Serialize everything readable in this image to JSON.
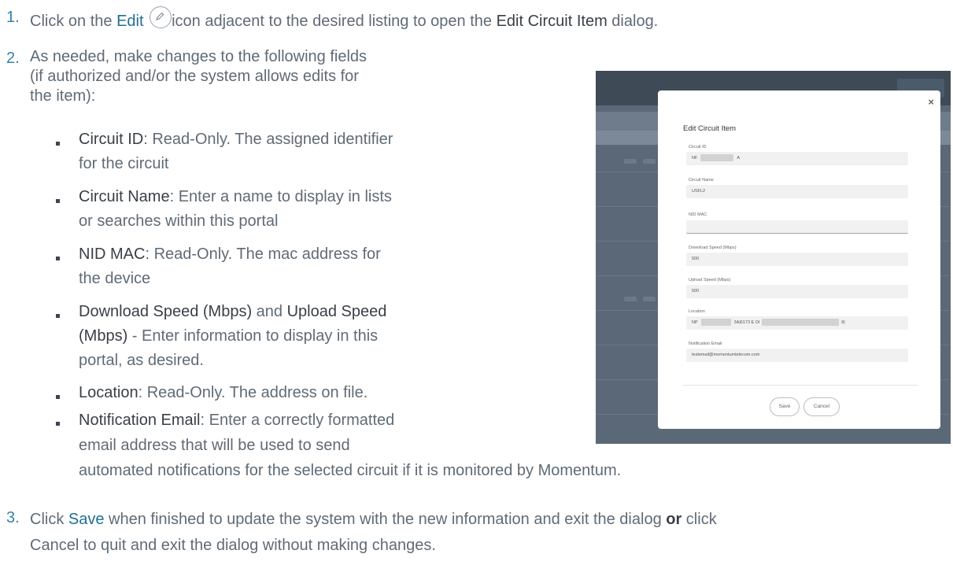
{
  "steps": {
    "s1": {
      "num": "1.",
      "pre": "Click on the ",
      "edit": "Edit",
      "mid": "icon adjacent to the desired listing to open the ",
      "dialog": "Edit Circuit Item",
      "post": " dialog."
    },
    "s2": {
      "num": "2.",
      "line1": "As needed, make changes to the following fields",
      "line2": "(if authorized and/or the system allows edits for",
      "line3": "the item):"
    },
    "s3": {
      "num": "3.",
      "pre": "Click ",
      "save": "Save",
      "line1_rest": " when finished to update the system with the new information and exit the dialog ",
      "or": "or",
      "line1_end": " click",
      "cancel": "Cancel",
      "line2_rest": " to quit and exit the dialog without making changes."
    }
  },
  "bullets": {
    "circuit_id": {
      "label": "Circuit ID",
      "line1": ": Read-Only. The assigned identifier",
      "line2": "for the circuit"
    },
    "circuit_name": {
      "label": "Circuit Name",
      "line1": ": Enter a name to display in lists",
      "line2": "or searches within this portal"
    },
    "nid_mac": {
      "label": "NID MAC",
      "line1": ": Read-Only. The mac address for",
      "line2": "the device"
    },
    "speed": {
      "label1": "Download Speed (Mbps)",
      "and": " and ",
      "label2a": "Upload Speed",
      "label2b": "(Mbps)",
      "line2": " - Enter information to display in this",
      "line3": "portal, as desired."
    },
    "location": {
      "label": "Location",
      "line1": ": Read-Only. The address on file."
    },
    "notification": {
      "label": "Notification Email",
      "line1": ": Enter a correctly formatted",
      "line2": "email address that will be used to send",
      "line3": "automated notifications for the selected circuit if it is monitored by Momentum."
    }
  },
  "dialog": {
    "title": "Edit Circuit Item",
    "close": "×",
    "fields": {
      "circuit_id": {
        "label": "Circuit ID",
        "value_a": "NF",
        "value_b": "A"
      },
      "circuit_name": {
        "label": "Circuit Name",
        "value": "USFL2"
      },
      "nid_mac": {
        "label": "NID MAC",
        "value": ""
      },
      "download": {
        "label": "Download Speed (Mbps)",
        "value": "500"
      },
      "upload": {
        "label": "Upload Speed (Mbps)",
        "value": "500"
      },
      "location": {
        "label": "Location",
        "value_a": "NP",
        "value_b": "3A|6173 E Ol",
        "value_c": "8|"
      },
      "email": {
        "label": "Notification Email",
        "value": "testemail@momentumtelecom.com"
      }
    },
    "save": "Save",
    "cancel": "Cancel"
  },
  "icons": {
    "edit": "pencil-icon",
    "bullet": "square-bullet-icon",
    "close": "close-icon"
  }
}
